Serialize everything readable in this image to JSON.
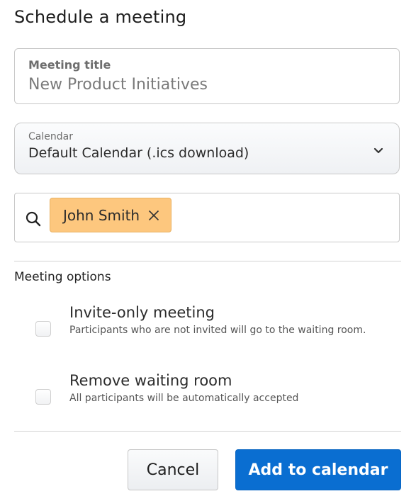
{
  "dialog": {
    "title": "Schedule a meeting"
  },
  "meeting_title": {
    "label": "Meeting title",
    "value": "New Product Initiatives"
  },
  "calendar": {
    "label": "Calendar",
    "selected": "Default Calendar (.ics download)",
    "icon": "chevron-down-icon"
  },
  "attendees": {
    "search_icon": "search-icon",
    "chips": [
      {
        "name": "John Smith",
        "remove_icon": "close-icon",
        "color": "#fdc77e"
      }
    ]
  },
  "options": {
    "section_label": "Meeting options",
    "items": [
      {
        "title": "Invite-only meeting",
        "description": "Participants who are not invited will go to the waiting room.",
        "checked": false
      },
      {
        "title": "Remove waiting room",
        "description": "All participants will be automatically accepted",
        "checked": false
      }
    ]
  },
  "footer": {
    "cancel_label": "Cancel",
    "add_label": "Add to calendar",
    "primary_color": "#0a6ed1"
  }
}
